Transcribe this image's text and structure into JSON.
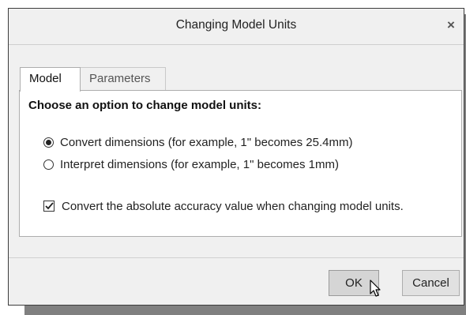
{
  "dialog": {
    "title": "Changing Model Units",
    "close_label": "×"
  },
  "tabs": [
    {
      "label": "Model",
      "active": true
    },
    {
      "label": "Parameters",
      "active": false
    }
  ],
  "model_tab": {
    "heading": "Choose an option to change model units:",
    "options": [
      {
        "label": "Convert dimensions (for example, 1\" becomes 25.4mm)",
        "selected": true
      },
      {
        "label": "Interpret dimensions (for example, 1\" becomes 1mm)",
        "selected": false
      }
    ],
    "accuracy_checkbox": {
      "label": "Convert the absolute accuracy value when changing model units.",
      "checked": true
    }
  },
  "buttons": {
    "ok_label": "OK",
    "cancel_label": "Cancel"
  }
}
